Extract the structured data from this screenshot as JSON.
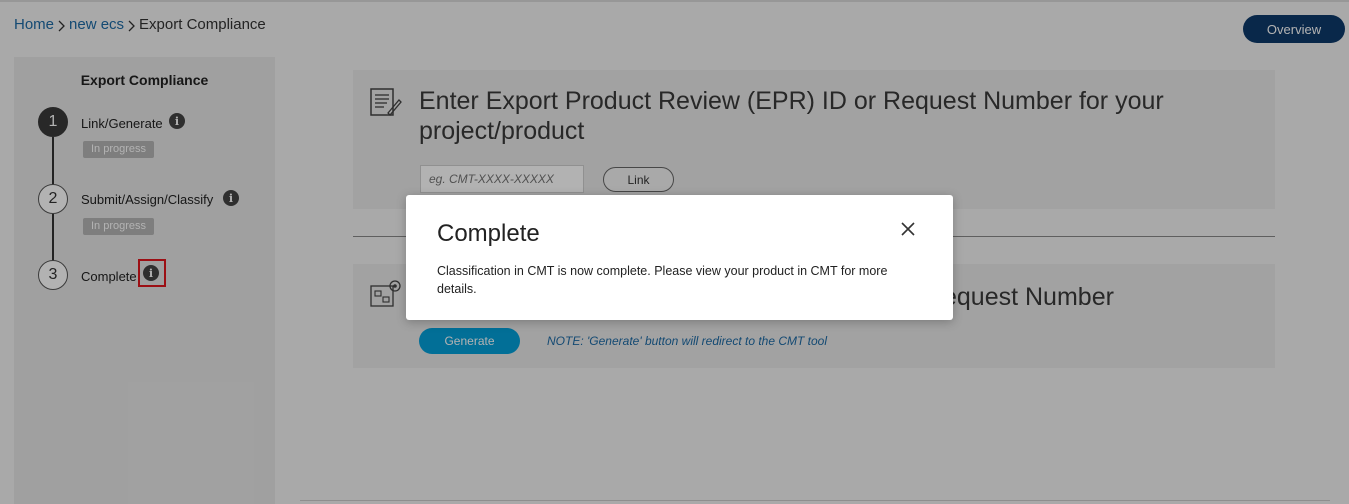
{
  "breadcrumb": {
    "items": [
      "Home",
      "new ecs",
      "Export Compliance"
    ]
  },
  "header": {
    "overview_label": "Overview"
  },
  "sidebar": {
    "title": "Export Compliance",
    "steps": [
      {
        "number": "1",
        "label": "Link/Generate",
        "status": "In progress",
        "active": true
      },
      {
        "number": "2",
        "label": "Submit/Assign/Classify",
        "status": "In progress",
        "active": false
      },
      {
        "number": "3",
        "label": "Complete",
        "status": "",
        "active": false
      }
    ],
    "info_glyph": "i"
  },
  "main": {
    "link_card": {
      "heading": "Enter Export Product Review (EPR) ID or Request Number for your project/product",
      "input_placeholder": "eg. CMT-XXXX-XXXXX",
      "link_label": "Link",
      "icon": "form-edit-icon"
    },
    "generate_card": {
      "heading_visible": "equest Number",
      "generate_label": "Generate",
      "note": "NOTE: 'Generate' button will redirect to the CMT tool",
      "icon": "blueprint-gear-icon"
    }
  },
  "modal": {
    "title": "Complete",
    "body": "Classification in CMT is now complete. Please view your product in CMT for more details.",
    "close_icon": "close-icon"
  },
  "colors": {
    "link": "#1d6aa5",
    "overview_bg": "#0e3a6b",
    "generate_bg": "#049fd9",
    "highlight": "#e0161d"
  }
}
